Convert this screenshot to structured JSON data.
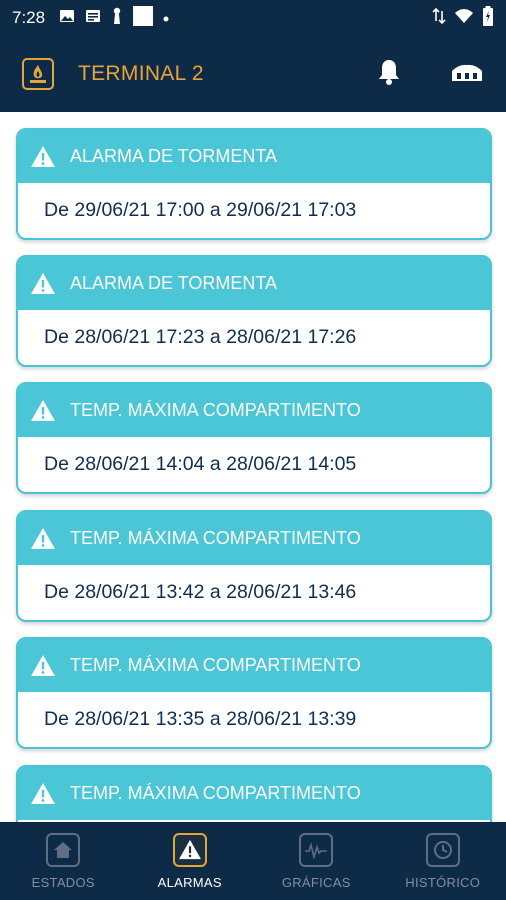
{
  "status_bar": {
    "time": "7:28"
  },
  "header": {
    "title": "TERMINAL 2"
  },
  "alarms": [
    {
      "title": "ALARMA DE TORMENTA",
      "range": "De 29/06/21 17:00 a 29/06/21 17:03"
    },
    {
      "title": "ALARMA DE TORMENTA",
      "range": "De 28/06/21 17:23 a 28/06/21 17:26"
    },
    {
      "title": "TEMP. MÁXIMA COMPARTIMENTO",
      "range": "De 28/06/21 14:04 a 28/06/21 14:05"
    },
    {
      "title": "TEMP. MÁXIMA COMPARTIMENTO",
      "range": "De 28/06/21 13:42 a 28/06/21 13:46"
    },
    {
      "title": "TEMP. MÁXIMA COMPARTIMENTO",
      "range": "De 28/06/21 13:35 a 28/06/21 13:39"
    },
    {
      "title": "TEMP. MÁXIMA COMPARTIMENTO",
      "range": ""
    }
  ],
  "nav": [
    {
      "label": "ESTADOS",
      "icon": "home-icon",
      "active": false
    },
    {
      "label": "ALARMAS",
      "icon": "warning-icon",
      "active": true
    },
    {
      "label": "GRÁFICAS",
      "icon": "chart-icon",
      "active": false
    },
    {
      "label": "HISTÓRICO",
      "icon": "history-icon",
      "active": false
    }
  ],
  "colors": {
    "primary": "#0d2a47",
    "accent": "#e8a33a",
    "card_header": "#4ac6d6",
    "card_text": "#0e2f52"
  }
}
